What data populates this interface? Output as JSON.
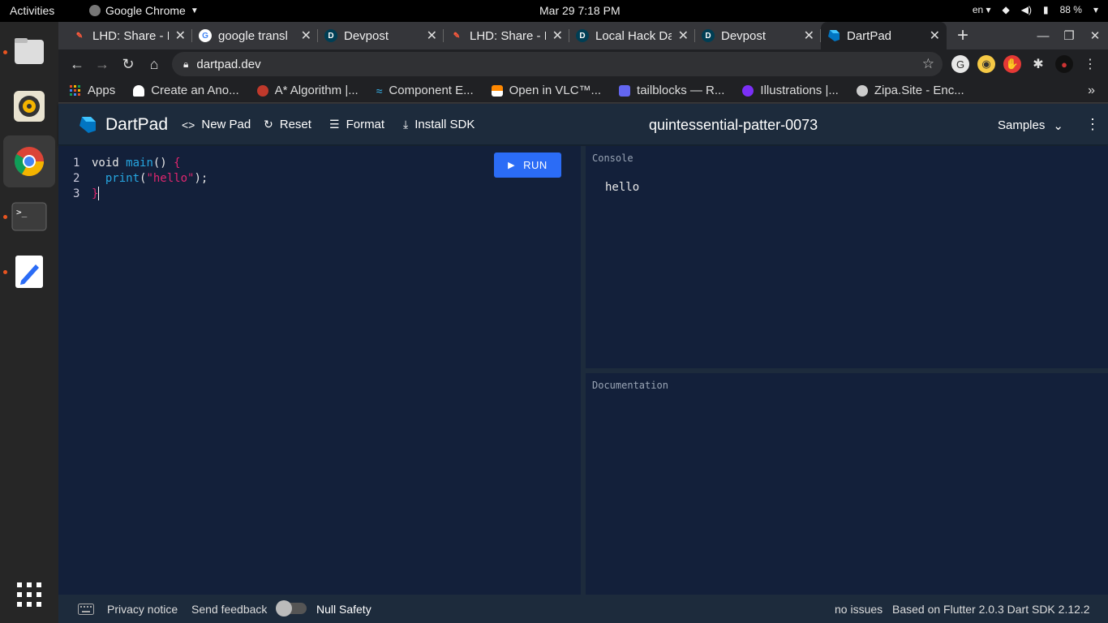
{
  "os": {
    "activities": "Activities",
    "app_name": "Google Chrome",
    "clock": "Mar 29  7:18 PM",
    "lang": "en",
    "battery": "88 %"
  },
  "tabs": [
    {
      "title": "LHD: Share - D",
      "favicon": "lhd-icon",
      "color": "#ff5a3c"
    },
    {
      "title": "google transl",
      "favicon": "google-icon",
      "color": "#4285f4"
    },
    {
      "title": "Devpost",
      "favicon": "devpost-icon",
      "color": "#003e54"
    },
    {
      "title": "LHD: Share - D",
      "favicon": "lhd-icon",
      "color": "#ff5a3c"
    },
    {
      "title": "Local Hack Da",
      "favicon": "devpost-icon",
      "color": "#003e54"
    },
    {
      "title": "Devpost",
      "favicon": "devpost-icon",
      "color": "#003e54"
    },
    {
      "title": "DartPad",
      "favicon": "dart-icon",
      "color": "#0175c2",
      "active": true
    }
  ],
  "address": {
    "url": "dartpad.dev"
  },
  "bookmarks": [
    {
      "label": "Apps",
      "icon": "apps-grid-icon",
      "color": "#e34c26"
    },
    {
      "label": "Create an Ano...",
      "icon": "ghost-icon",
      "color": "#ffffff"
    },
    {
      "label": "A* Algorithm |...",
      "icon": "geeks-icon",
      "color": "#c0392b"
    },
    {
      "label": "Component E...",
      "icon": "tailwind-icon",
      "color": "#38bdf8"
    },
    {
      "label": "Open in VLC™...",
      "icon": "vlc-icon",
      "color": "#ff8800"
    },
    {
      "label": "tailblocks — R...",
      "icon": "tailblocks-icon",
      "color": "#6366f1"
    },
    {
      "label": "Illustrations |...",
      "icon": "illustrations-icon",
      "color": "#7b2ff7"
    },
    {
      "label": "Zipa.Site - Enc...",
      "icon": "globe-icon",
      "color": "#cccccc"
    }
  ],
  "dartpad": {
    "logo": "DartPad",
    "new_pad": "New Pad",
    "reset": "Reset",
    "format": "Format",
    "install_sdk": "Install SDK",
    "pad_title": "quintessential-patter-0073",
    "samples": "Samples",
    "run": "RUN",
    "code": {
      "l1_kw": "void",
      "l1_fn": "main",
      "l1_paren": "()",
      "l1_brace": "{",
      "l2_fn": "print",
      "l2_open": "(",
      "l2_str": "\"hello\"",
      "l2_close": ");",
      "l3_brace": "}"
    },
    "console_label": "Console",
    "console_output": "hello",
    "docs_label": "Documentation",
    "footer": {
      "privacy": "Privacy notice",
      "feedback": "Send feedback",
      "null_safety": "Null Safety",
      "issues": "no issues",
      "version": "Based on Flutter 2.0.3 Dart SDK 2.12.2"
    }
  }
}
